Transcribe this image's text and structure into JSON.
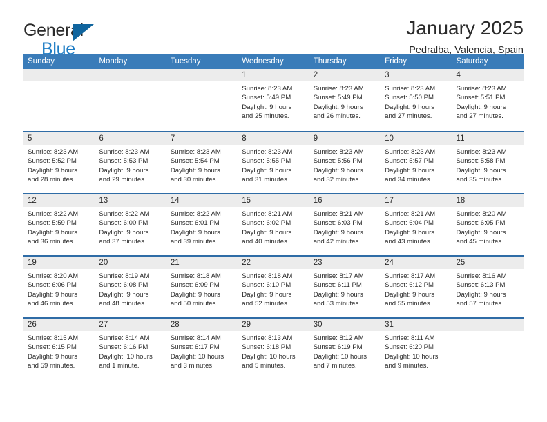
{
  "brand": {
    "name_part1": "General",
    "name_part2": "Blue",
    "flag_color": "#10659e",
    "text_color": "#1d7cc4"
  },
  "header": {
    "title": "January 2025",
    "subtitle": "Pedralba, Valencia, Spain"
  },
  "theme": {
    "header_row_bg": "#3a7cb9",
    "week_divider": "#2f6ca6",
    "datebar_bg": "#ececec",
    "text": "#2b2b2b"
  },
  "weekdays": [
    "Sunday",
    "Monday",
    "Tuesday",
    "Wednesday",
    "Thursday",
    "Friday",
    "Saturday"
  ],
  "weeks": [
    [
      {
        "day": "",
        "empty": true,
        "sunrise": "",
        "sunset": "",
        "daylight1": "",
        "daylight2": ""
      },
      {
        "day": "",
        "empty": true,
        "sunrise": "",
        "sunset": "",
        "daylight1": "",
        "daylight2": ""
      },
      {
        "day": "",
        "empty": true,
        "sunrise": "",
        "sunset": "",
        "daylight1": "",
        "daylight2": ""
      },
      {
        "day": "1",
        "sunrise": "Sunrise: 8:23 AM",
        "sunset": "Sunset: 5:49 PM",
        "daylight1": "Daylight: 9 hours",
        "daylight2": "and 25 minutes."
      },
      {
        "day": "2",
        "sunrise": "Sunrise: 8:23 AM",
        "sunset": "Sunset: 5:49 PM",
        "daylight1": "Daylight: 9 hours",
        "daylight2": "and 26 minutes."
      },
      {
        "day": "3",
        "sunrise": "Sunrise: 8:23 AM",
        "sunset": "Sunset: 5:50 PM",
        "daylight1": "Daylight: 9 hours",
        "daylight2": "and 27 minutes."
      },
      {
        "day": "4",
        "sunrise": "Sunrise: 8:23 AM",
        "sunset": "Sunset: 5:51 PM",
        "daylight1": "Daylight: 9 hours",
        "daylight2": "and 27 minutes."
      }
    ],
    [
      {
        "day": "5",
        "sunrise": "Sunrise: 8:23 AM",
        "sunset": "Sunset: 5:52 PM",
        "daylight1": "Daylight: 9 hours",
        "daylight2": "and 28 minutes."
      },
      {
        "day": "6",
        "sunrise": "Sunrise: 8:23 AM",
        "sunset": "Sunset: 5:53 PM",
        "daylight1": "Daylight: 9 hours",
        "daylight2": "and 29 minutes."
      },
      {
        "day": "7",
        "sunrise": "Sunrise: 8:23 AM",
        "sunset": "Sunset: 5:54 PM",
        "daylight1": "Daylight: 9 hours",
        "daylight2": "and 30 minutes."
      },
      {
        "day": "8",
        "sunrise": "Sunrise: 8:23 AM",
        "sunset": "Sunset: 5:55 PM",
        "daylight1": "Daylight: 9 hours",
        "daylight2": "and 31 minutes."
      },
      {
        "day": "9",
        "sunrise": "Sunrise: 8:23 AM",
        "sunset": "Sunset: 5:56 PM",
        "daylight1": "Daylight: 9 hours",
        "daylight2": "and 32 minutes."
      },
      {
        "day": "10",
        "sunrise": "Sunrise: 8:23 AM",
        "sunset": "Sunset: 5:57 PM",
        "daylight1": "Daylight: 9 hours",
        "daylight2": "and 34 minutes."
      },
      {
        "day": "11",
        "sunrise": "Sunrise: 8:23 AM",
        "sunset": "Sunset: 5:58 PM",
        "daylight1": "Daylight: 9 hours",
        "daylight2": "and 35 minutes."
      }
    ],
    [
      {
        "day": "12",
        "sunrise": "Sunrise: 8:22 AM",
        "sunset": "Sunset: 5:59 PM",
        "daylight1": "Daylight: 9 hours",
        "daylight2": "and 36 minutes."
      },
      {
        "day": "13",
        "sunrise": "Sunrise: 8:22 AM",
        "sunset": "Sunset: 6:00 PM",
        "daylight1": "Daylight: 9 hours",
        "daylight2": "and 37 minutes."
      },
      {
        "day": "14",
        "sunrise": "Sunrise: 8:22 AM",
        "sunset": "Sunset: 6:01 PM",
        "daylight1": "Daylight: 9 hours",
        "daylight2": "and 39 minutes."
      },
      {
        "day": "15",
        "sunrise": "Sunrise: 8:21 AM",
        "sunset": "Sunset: 6:02 PM",
        "daylight1": "Daylight: 9 hours",
        "daylight2": "and 40 minutes."
      },
      {
        "day": "16",
        "sunrise": "Sunrise: 8:21 AM",
        "sunset": "Sunset: 6:03 PM",
        "daylight1": "Daylight: 9 hours",
        "daylight2": "and 42 minutes."
      },
      {
        "day": "17",
        "sunrise": "Sunrise: 8:21 AM",
        "sunset": "Sunset: 6:04 PM",
        "daylight1": "Daylight: 9 hours",
        "daylight2": "and 43 minutes."
      },
      {
        "day": "18",
        "sunrise": "Sunrise: 8:20 AM",
        "sunset": "Sunset: 6:05 PM",
        "daylight1": "Daylight: 9 hours",
        "daylight2": "and 45 minutes."
      }
    ],
    [
      {
        "day": "19",
        "sunrise": "Sunrise: 8:20 AM",
        "sunset": "Sunset: 6:06 PM",
        "daylight1": "Daylight: 9 hours",
        "daylight2": "and 46 minutes."
      },
      {
        "day": "20",
        "sunrise": "Sunrise: 8:19 AM",
        "sunset": "Sunset: 6:08 PM",
        "daylight1": "Daylight: 9 hours",
        "daylight2": "and 48 minutes."
      },
      {
        "day": "21",
        "sunrise": "Sunrise: 8:18 AM",
        "sunset": "Sunset: 6:09 PM",
        "daylight1": "Daylight: 9 hours",
        "daylight2": "and 50 minutes."
      },
      {
        "day": "22",
        "sunrise": "Sunrise: 8:18 AM",
        "sunset": "Sunset: 6:10 PM",
        "daylight1": "Daylight: 9 hours",
        "daylight2": "and 52 minutes."
      },
      {
        "day": "23",
        "sunrise": "Sunrise: 8:17 AM",
        "sunset": "Sunset: 6:11 PM",
        "daylight1": "Daylight: 9 hours",
        "daylight2": "and 53 minutes."
      },
      {
        "day": "24",
        "sunrise": "Sunrise: 8:17 AM",
        "sunset": "Sunset: 6:12 PM",
        "daylight1": "Daylight: 9 hours",
        "daylight2": "and 55 minutes."
      },
      {
        "day": "25",
        "sunrise": "Sunrise: 8:16 AM",
        "sunset": "Sunset: 6:13 PM",
        "daylight1": "Daylight: 9 hours",
        "daylight2": "and 57 minutes."
      }
    ],
    [
      {
        "day": "26",
        "sunrise": "Sunrise: 8:15 AM",
        "sunset": "Sunset: 6:15 PM",
        "daylight1": "Daylight: 9 hours",
        "daylight2": "and 59 minutes."
      },
      {
        "day": "27",
        "sunrise": "Sunrise: 8:14 AM",
        "sunset": "Sunset: 6:16 PM",
        "daylight1": "Daylight: 10 hours",
        "daylight2": "and 1 minute."
      },
      {
        "day": "28",
        "sunrise": "Sunrise: 8:14 AM",
        "sunset": "Sunset: 6:17 PM",
        "daylight1": "Daylight: 10 hours",
        "daylight2": "and 3 minutes."
      },
      {
        "day": "29",
        "sunrise": "Sunrise: 8:13 AM",
        "sunset": "Sunset: 6:18 PM",
        "daylight1": "Daylight: 10 hours",
        "daylight2": "and 5 minutes."
      },
      {
        "day": "30",
        "sunrise": "Sunrise: 8:12 AM",
        "sunset": "Sunset: 6:19 PM",
        "daylight1": "Daylight: 10 hours",
        "daylight2": "and 7 minutes."
      },
      {
        "day": "31",
        "sunrise": "Sunrise: 8:11 AM",
        "sunset": "Sunset: 6:20 PM",
        "daylight1": "Daylight: 10 hours",
        "daylight2": "and 9 minutes."
      },
      {
        "day": "",
        "empty": true,
        "sunrise": "",
        "sunset": "",
        "daylight1": "",
        "daylight2": ""
      }
    ]
  ]
}
